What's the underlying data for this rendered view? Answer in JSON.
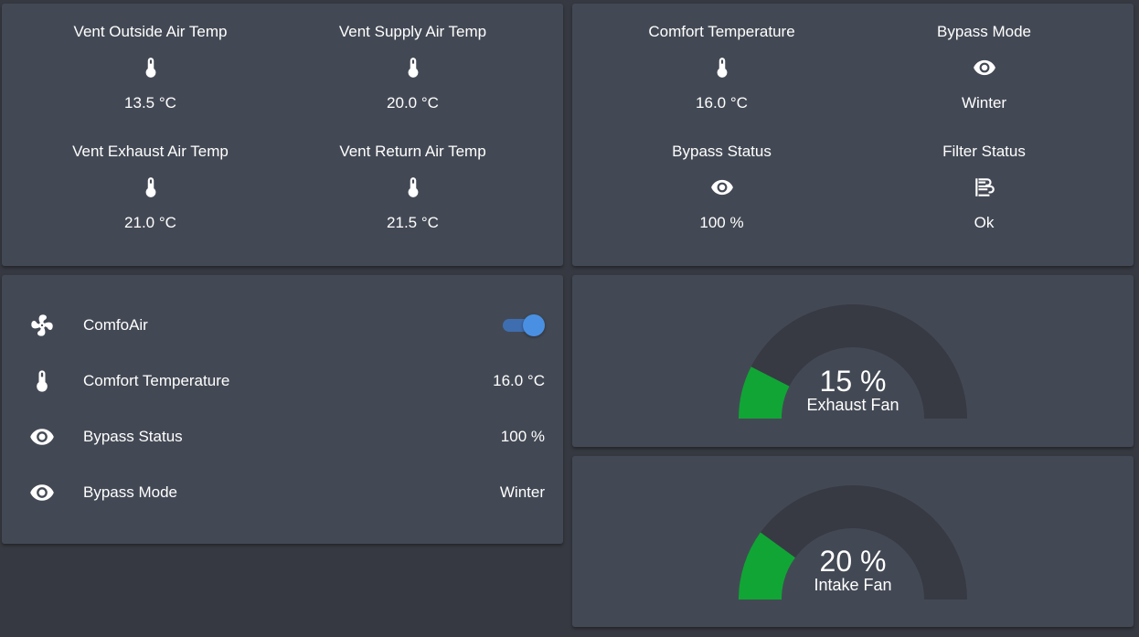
{
  "temps_card": {
    "items": [
      {
        "name": "Vent Outside Air Temp",
        "state": "13.5 °C",
        "icon": "thermometer-icon"
      },
      {
        "name": "Vent Supply Air Temp",
        "state": "20.0 °C",
        "icon": "thermometer-icon"
      },
      {
        "name": "Vent Exhaust Air Temp",
        "state": "21.0 °C",
        "icon": "thermometer-icon"
      },
      {
        "name": "Vent Return Air Temp",
        "state": "21.5 °C",
        "icon": "thermometer-icon"
      }
    ]
  },
  "status_card": {
    "items": [
      {
        "name": "Comfort Temperature",
        "state": "16.0 °C",
        "icon": "thermometer-icon"
      },
      {
        "name": "Bypass Mode",
        "state": "Winter",
        "icon": "eye-icon"
      },
      {
        "name": "Bypass Status",
        "state": "100 %",
        "icon": "eye-icon"
      },
      {
        "name": "Filter Status",
        "state": "Ok",
        "icon": "air-filter-icon"
      }
    ]
  },
  "entities_card": {
    "rows": [
      {
        "name": "ComfoAir",
        "icon": "fan-icon",
        "toggle_on": true
      },
      {
        "name": "Comfort Temperature",
        "state": "16.0 °C",
        "icon": "thermometer-icon"
      },
      {
        "name": "Bypass Status",
        "state": "100 %",
        "icon": "eye-icon"
      },
      {
        "name": "Bypass Mode",
        "state": "Winter",
        "icon": "eye-icon"
      }
    ]
  },
  "gauges": {
    "exhaust": {
      "value_text": "15 %",
      "name": "Exhaust Fan",
      "value": 15,
      "min": 0,
      "max": 100
    },
    "intake": {
      "value_text": "20 %",
      "name": "Intake Fan",
      "value": 20,
      "min": 0,
      "max": 100
    }
  },
  "colors": {
    "background": "#363941",
    "card": "#434954",
    "gauge_fill": "#11a536",
    "gauge_track": "#373a43",
    "toggle_on": "#4a90e2"
  }
}
